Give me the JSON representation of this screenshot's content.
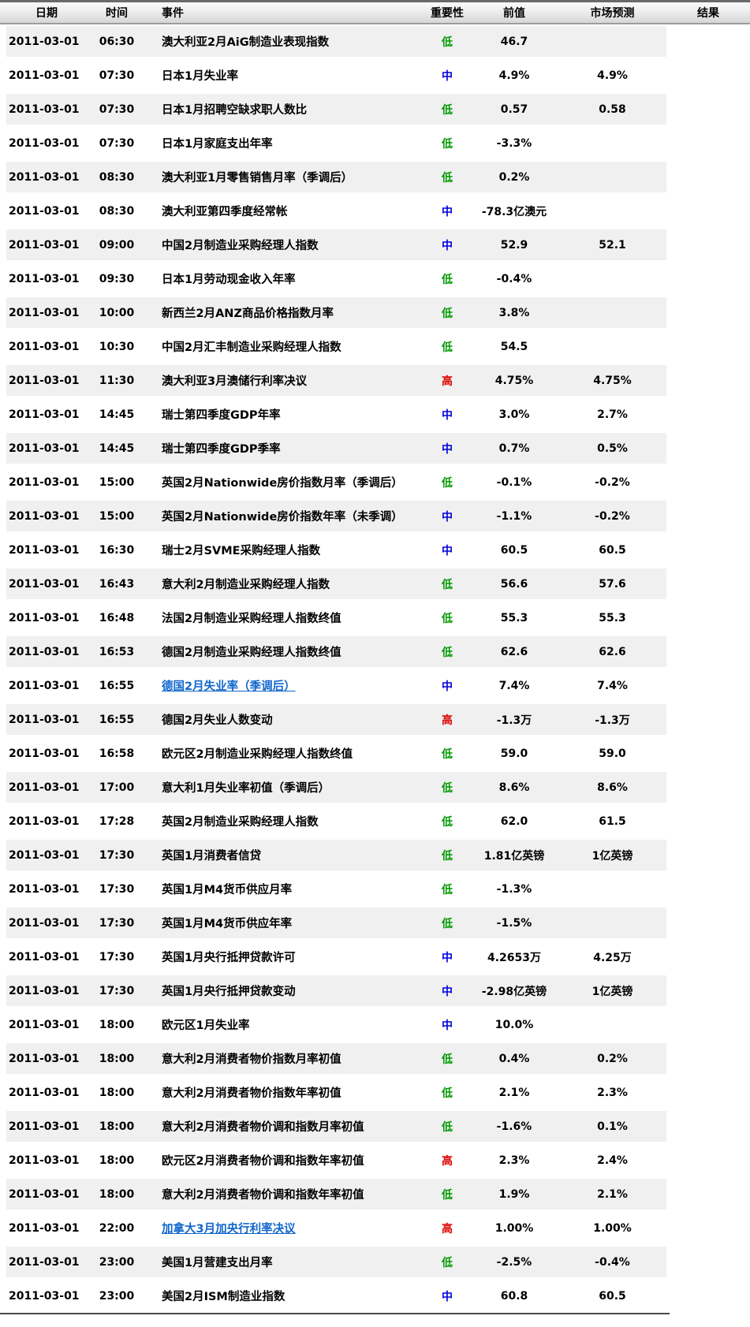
{
  "header": {
    "columns": [
      "日期",
      "时间",
      "事件",
      "重要性",
      "前值",
      "市场预测",
      "结果"
    ]
  },
  "importance_colors": {
    "低": "#009900",
    "中": "#0000dd",
    "高": "#dd0000"
  },
  "link_color": "#1166cc",
  "stripe_color": "#f0f0f0",
  "rows": [
    {
      "date": "2011-03-01",
      "time": "06:30",
      "event": "澳大利亚2月AiG制造业表现指数",
      "importance": "低",
      "previous": "46.7",
      "forecast": "",
      "result": "",
      "link": false
    },
    {
      "date": "2011-03-01",
      "time": "07:30",
      "event": "日本1月失业率",
      "importance": "中",
      "previous": "4.9%",
      "forecast": "4.9%",
      "result": "",
      "link": false
    },
    {
      "date": "2011-03-01",
      "time": "07:30",
      "event": "日本1月招聘空缺求职人数比",
      "importance": "低",
      "previous": "0.57",
      "forecast": "0.58",
      "result": "",
      "link": false
    },
    {
      "date": "2011-03-01",
      "time": "07:30",
      "event": "日本1月家庭支出年率",
      "importance": "低",
      "previous": "-3.3%",
      "forecast": "",
      "result": "",
      "link": false
    },
    {
      "date": "2011-03-01",
      "time": "08:30",
      "event": "澳大利亚1月零售销售月率（季调后）",
      "importance": "低",
      "previous": "0.2%",
      "forecast": "",
      "result": "",
      "link": false
    },
    {
      "date": "2011-03-01",
      "time": "08:30",
      "event": "澳大利亚第四季度经常帐",
      "importance": "中",
      "previous": "-78.3亿澳元",
      "forecast": "",
      "result": "",
      "link": false
    },
    {
      "date": "2011-03-01",
      "time": "09:00",
      "event": "中国2月制造业采购经理人指数",
      "importance": "中",
      "previous": "52.9",
      "forecast": "52.1",
      "result": "",
      "link": false
    },
    {
      "date": "2011-03-01",
      "time": "09:30",
      "event": "日本1月劳动现金收入年率",
      "importance": "低",
      "previous": "-0.4%",
      "forecast": "",
      "result": "",
      "link": false
    },
    {
      "date": "2011-03-01",
      "time": "10:00",
      "event": "新西兰2月ANZ商品价格指数月率",
      "importance": "低",
      "previous": "3.8%",
      "forecast": "",
      "result": "",
      "link": false
    },
    {
      "date": "2011-03-01",
      "time": "10:30",
      "event": "中国2月汇丰制造业采购经理人指数",
      "importance": "低",
      "previous": "54.5",
      "forecast": "",
      "result": "",
      "link": false
    },
    {
      "date": "2011-03-01",
      "time": "11:30",
      "event": "澳大利亚3月澳储行利率决议",
      "importance": "高",
      "previous": "4.75%",
      "forecast": "4.75%",
      "result": "",
      "link": false
    },
    {
      "date": "2011-03-01",
      "time": "14:45",
      "event": "瑞士第四季度GDP年率",
      "importance": "中",
      "previous": "3.0%",
      "forecast": "2.7%",
      "result": "",
      "link": false
    },
    {
      "date": "2011-03-01",
      "time": "14:45",
      "event": "瑞士第四季度GDP季率",
      "importance": "中",
      "previous": "0.7%",
      "forecast": "0.5%",
      "result": "",
      "link": false
    },
    {
      "date": "2011-03-01",
      "time": "15:00",
      "event": "英国2月Nationwide房价指数月率（季调后）",
      "importance": "低",
      "previous": "-0.1%",
      "forecast": "-0.2%",
      "result": "",
      "link": false
    },
    {
      "date": "2011-03-01",
      "time": "15:00",
      "event": "英国2月Nationwide房价指数年率（未季调）",
      "importance": "中",
      "previous": "-1.1%",
      "forecast": "-0.2%",
      "result": "",
      "link": false
    },
    {
      "date": "2011-03-01",
      "time": "16:30",
      "event": "瑞士2月SVME采购经理人指数",
      "importance": "中",
      "previous": "60.5",
      "forecast": "60.5",
      "result": "",
      "link": false
    },
    {
      "date": "2011-03-01",
      "time": "16:43",
      "event": "意大利2月制造业采购经理人指数",
      "importance": "低",
      "previous": "56.6",
      "forecast": "57.6",
      "result": "",
      "link": false
    },
    {
      "date": "2011-03-01",
      "time": "16:48",
      "event": "法国2月制造业采购经理人指数终值",
      "importance": "低",
      "previous": "55.3",
      "forecast": "55.3",
      "result": "",
      "link": false
    },
    {
      "date": "2011-03-01",
      "time": "16:53",
      "event": "德国2月制造业采购经理人指数终值",
      "importance": "低",
      "previous": "62.6",
      "forecast": "62.6",
      "result": "",
      "link": false
    },
    {
      "date": "2011-03-01",
      "time": "16:55",
      "event": "德国2月失业率（季调后）",
      "importance": "中",
      "previous": "7.4%",
      "forecast": "7.4%",
      "result": "",
      "link": true
    },
    {
      "date": "2011-03-01",
      "time": "16:55",
      "event": "德国2月失业人数变动",
      "importance": "高",
      "previous": "-1.3万",
      "forecast": "-1.3万",
      "result": "",
      "link": false
    },
    {
      "date": "2011-03-01",
      "time": "16:58",
      "event": "欧元区2月制造业采购经理人指数终值",
      "importance": "低",
      "previous": "59.0",
      "forecast": "59.0",
      "result": "",
      "link": false
    },
    {
      "date": "2011-03-01",
      "time": "17:00",
      "event": "意大利1月失业率初值（季调后）",
      "importance": "低",
      "previous": "8.6%",
      "forecast": "8.6%",
      "result": "",
      "link": false
    },
    {
      "date": "2011-03-01",
      "time": "17:28",
      "event": "英国2月制造业采购经理人指数",
      "importance": "低",
      "previous": "62.0",
      "forecast": "61.5",
      "result": "",
      "link": false
    },
    {
      "date": "2011-03-01",
      "time": "17:30",
      "event": "英国1月消费者信贷",
      "importance": "低",
      "previous": "1.81亿英镑",
      "forecast": "1亿英镑",
      "result": "",
      "link": false
    },
    {
      "date": "2011-03-01",
      "time": "17:30",
      "event": "英国1月M4货币供应月率",
      "importance": "低",
      "previous": "-1.3%",
      "forecast": "",
      "result": "",
      "link": false
    },
    {
      "date": "2011-03-01",
      "time": "17:30",
      "event": "英国1月M4货币供应年率",
      "importance": "低",
      "previous": "-1.5%",
      "forecast": "",
      "result": "",
      "link": false
    },
    {
      "date": "2011-03-01",
      "time": "17:30",
      "event": "英国1月央行抵押贷款许可",
      "importance": "中",
      "previous": "4.2653万",
      "forecast": "4.25万",
      "result": "",
      "link": false
    },
    {
      "date": "2011-03-01",
      "time": "17:30",
      "event": "英国1月央行抵押贷款变动",
      "importance": "中",
      "previous": "-2.98亿英镑",
      "forecast": "1亿英镑",
      "result": "",
      "link": false
    },
    {
      "date": "2011-03-01",
      "time": "18:00",
      "event": "欧元区1月失业率",
      "importance": "中",
      "previous": "10.0%",
      "forecast": "",
      "result": "",
      "link": false
    },
    {
      "date": "2011-03-01",
      "time": "18:00",
      "event": "意大利2月消费者物价指数月率初值",
      "importance": "低",
      "previous": "0.4%",
      "forecast": "0.2%",
      "result": "",
      "link": false
    },
    {
      "date": "2011-03-01",
      "time": "18:00",
      "event": "意大利2月消费者物价指数年率初值",
      "importance": "低",
      "previous": "2.1%",
      "forecast": "2.3%",
      "result": "",
      "link": false
    },
    {
      "date": "2011-03-01",
      "time": "18:00",
      "event": "意大利2月消费者物价调和指数月率初值",
      "importance": "低",
      "previous": "-1.6%",
      "forecast": "0.1%",
      "result": "",
      "link": false
    },
    {
      "date": "2011-03-01",
      "time": "18:00",
      "event": "欧元区2月消费者物价调和指数年率初值",
      "importance": "高",
      "previous": "2.3%",
      "forecast": "2.4%",
      "result": "",
      "link": false
    },
    {
      "date": "2011-03-01",
      "time": "18:00",
      "event": "意大利2月消费者物价调和指数年率初值",
      "importance": "低",
      "previous": "1.9%",
      "forecast": "2.1%",
      "result": "",
      "link": false
    },
    {
      "date": "2011-03-01",
      "time": "22:00",
      "event": "加拿大3月加央行利率决议",
      "importance": "高",
      "previous": "1.00%",
      "forecast": "1.00%",
      "result": "",
      "link": true
    },
    {
      "date": "2011-03-01",
      "time": "23:00",
      "event": "美国1月营建支出月率",
      "importance": "低",
      "previous": "-2.5%",
      "forecast": "-0.4%",
      "result": "",
      "link": false
    },
    {
      "date": "2011-03-01",
      "time": "23:00",
      "event": "美国2月ISM制造业指数",
      "importance": "中",
      "previous": "60.8",
      "forecast": "60.5",
      "result": "",
      "link": false
    }
  ]
}
